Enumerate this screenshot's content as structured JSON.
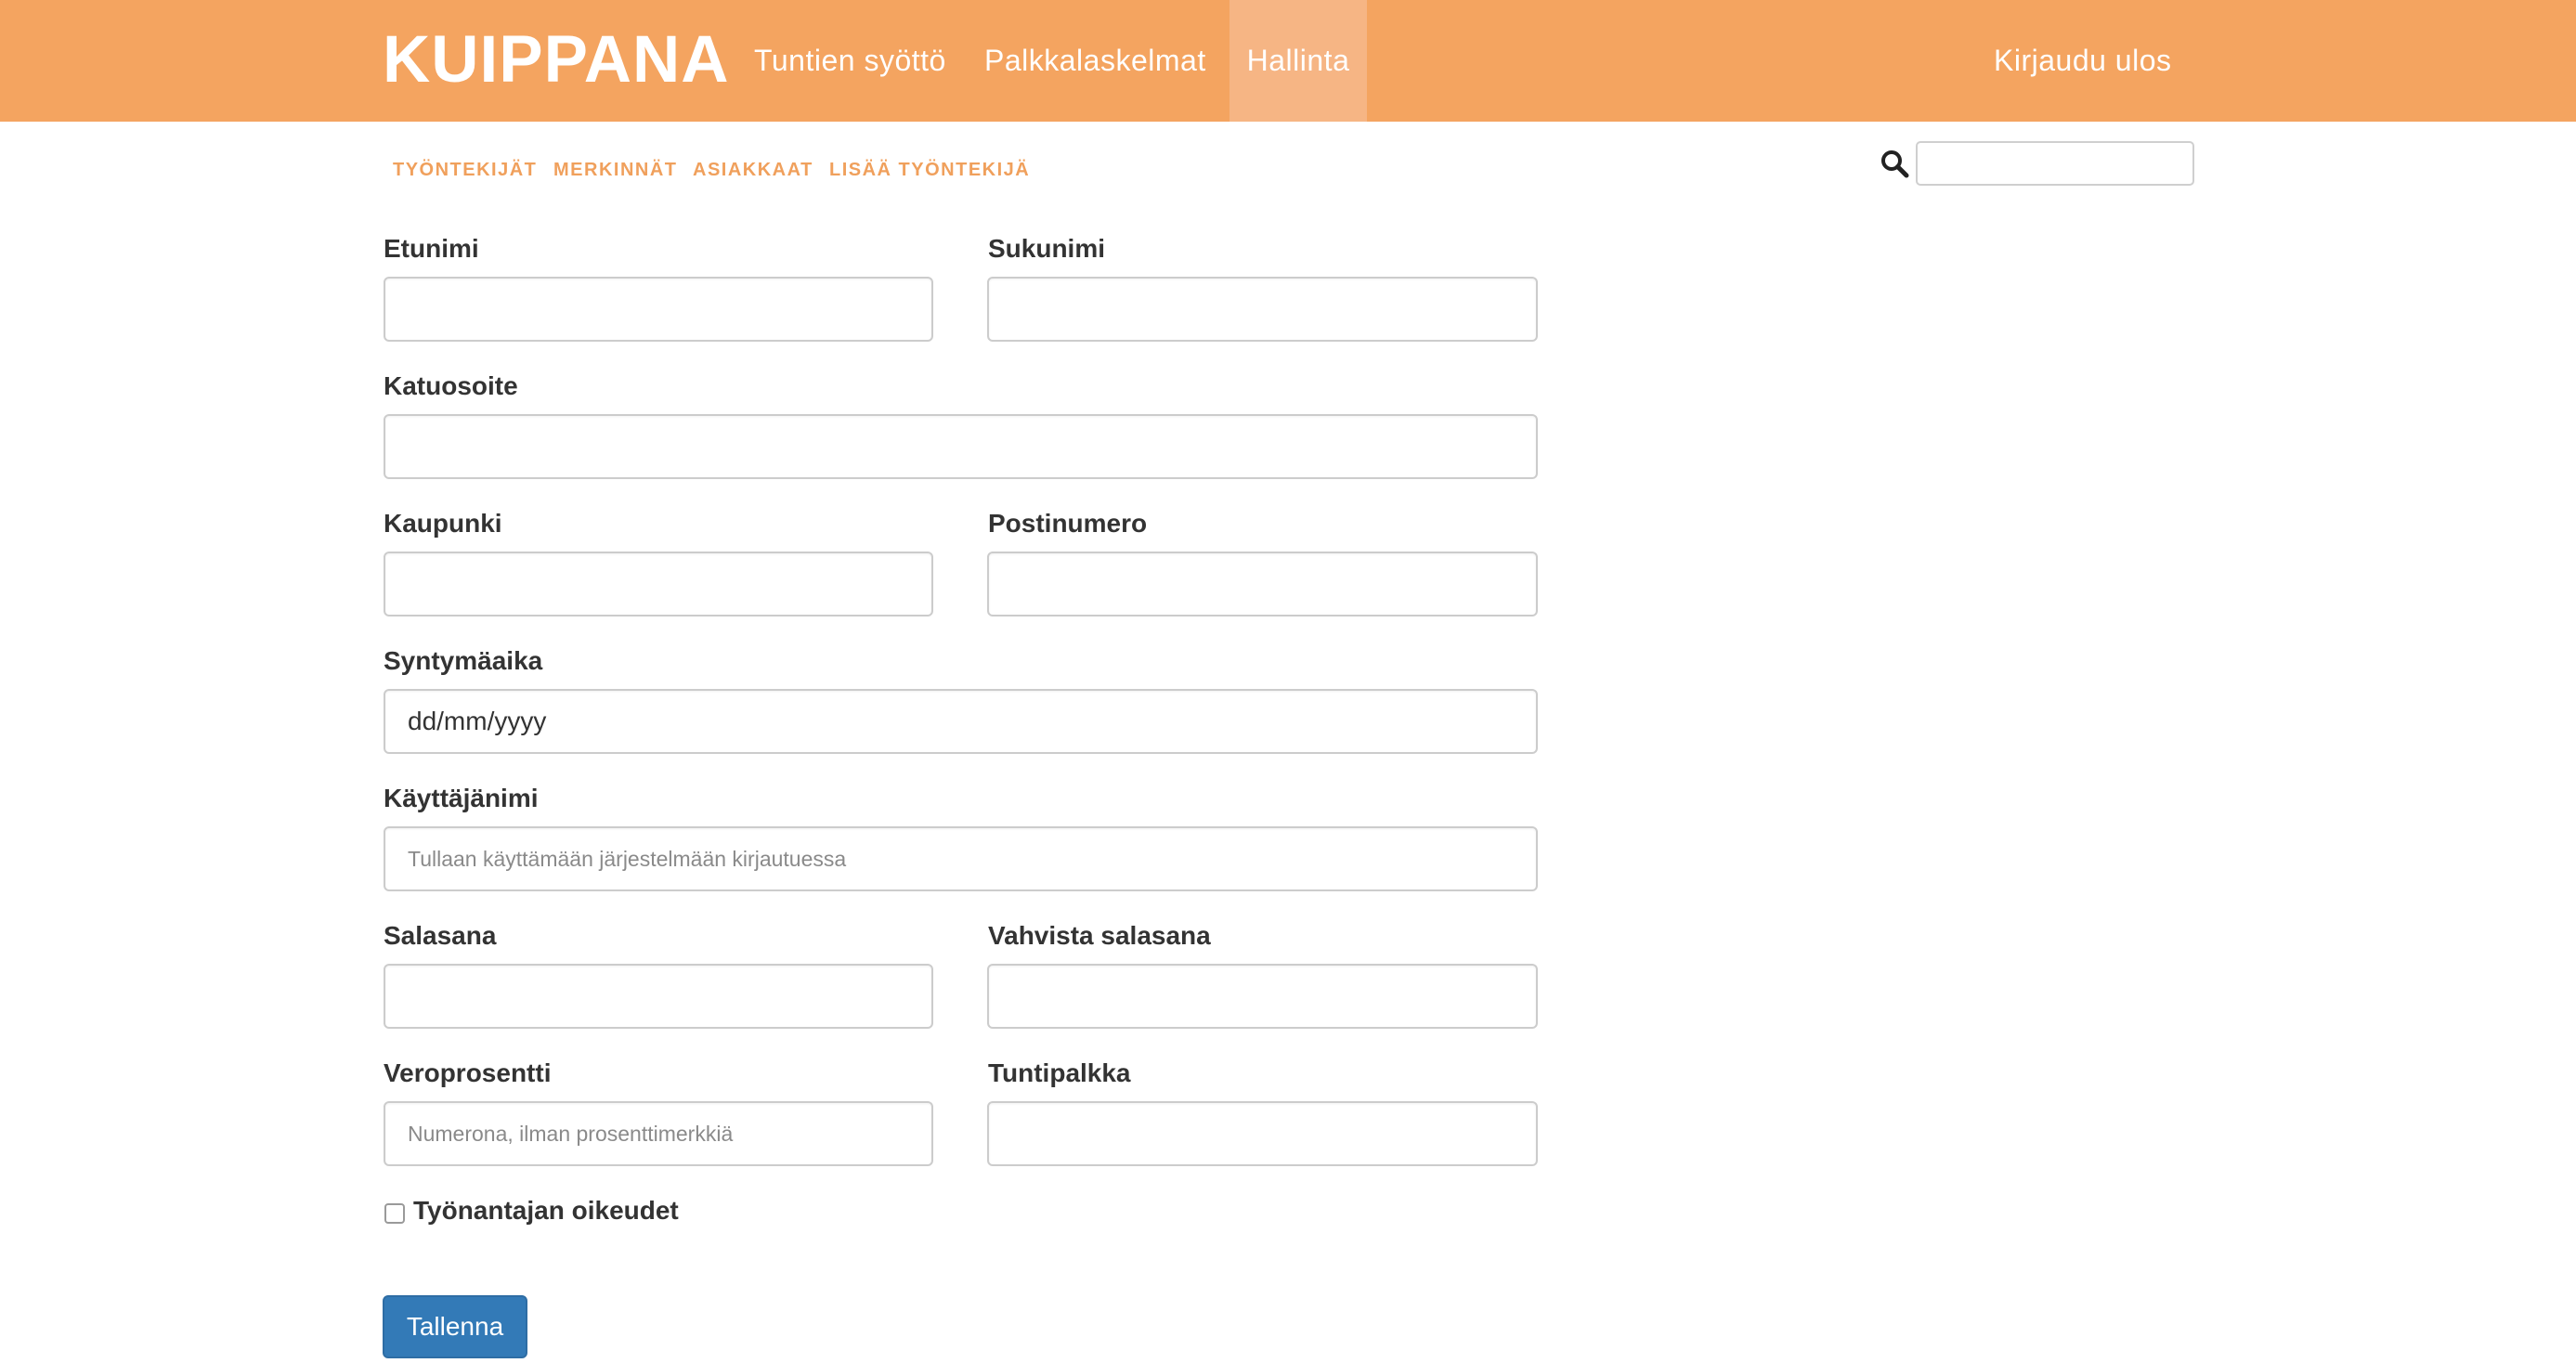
{
  "header": {
    "brand": "KUIPPANA",
    "nav": {
      "tuntien_syotto": "Tuntien syöttö",
      "palkkalaskelmat": "Palkkalaskelmat",
      "hallinta": "Hallinta",
      "logout": "Kirjaudu ulos"
    },
    "active_tab": "Hallinta"
  },
  "subnav": {
    "tyontekijat": "TYÖNTEKIJÄT",
    "merkinnat": "MERKINNÄT",
    "asiakkaat": "ASIAKKAAT",
    "lisaa_tyontekija": "LISÄÄ TYÖNTEKIJÄ"
  },
  "search": {
    "value": "",
    "icon": "search-icon"
  },
  "form": {
    "etunimi": {
      "label": "Etunimi",
      "value": "",
      "placeholder": ""
    },
    "sukunimi": {
      "label": "Sukunimi",
      "value": "",
      "placeholder": ""
    },
    "katuosoite": {
      "label": "Katuosoite",
      "value": "",
      "placeholder": ""
    },
    "kaupunki": {
      "label": "Kaupunki",
      "value": "",
      "placeholder": ""
    },
    "postinumero": {
      "label": "Postinumero",
      "value": "",
      "placeholder": ""
    },
    "syntymaaika": {
      "label": "Syntymäaika",
      "value": "dd/mm/yyyy"
    },
    "kayttajanimi": {
      "label": "Käyttäjänimi",
      "value": "",
      "placeholder": "Tullaan käyttämään järjestelmään kirjautuessa"
    },
    "salasana": {
      "label": "Salasana",
      "value": ""
    },
    "vahvista_salasana": {
      "label": "Vahvista salasana",
      "value": ""
    },
    "veroprosentti": {
      "label": "Veroprosentti",
      "value": "",
      "placeholder": "Numerona, ilman prosenttimerkkiä"
    },
    "tuntipalkka": {
      "label": "Tuntipalkka",
      "value": "",
      "placeholder": ""
    },
    "tyonantajan_oikeudet": {
      "label": "Työnantajan oikeudet",
      "checked": false
    },
    "save_label": "Tallenna"
  },
  "colors": {
    "navbar": "#f4a460",
    "navbar_active": "#f6b584",
    "subnav_text": "#f0a05c",
    "primary_button": "#337ab7"
  }
}
